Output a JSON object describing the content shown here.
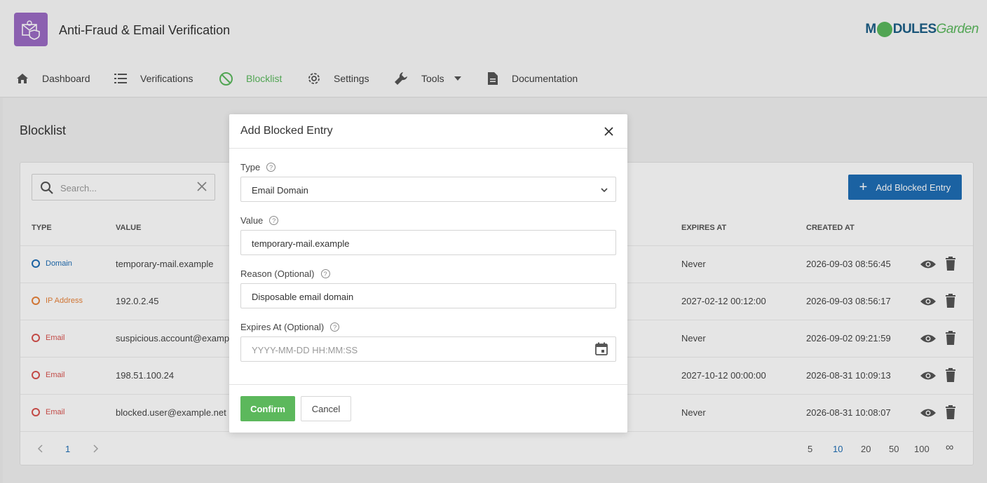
{
  "header": {
    "app_title": "Anti-Fraud & Email Verification",
    "brand": {
      "part1": "M",
      "part2": "DULES",
      "part3": "Garden"
    }
  },
  "nav": {
    "dashboard": "Dashboard",
    "verifications": "Verifications",
    "blocklist": "Blocklist",
    "settings": "Settings",
    "tools": "Tools",
    "documentation": "Documentation"
  },
  "page": {
    "title": "Blocklist",
    "search_placeholder": "Search...",
    "add_button": "Add Blocked Entry"
  },
  "table": {
    "headers": {
      "type": "TYPE",
      "value": "VALUE",
      "expires_at": "EXPIRES AT",
      "created_at": "CREATED AT"
    },
    "rows": [
      {
        "type": "Domain",
        "type_color": "#1f6eb5",
        "value": "temporary-mail.example",
        "expires": "Never",
        "created": "2026-09-03 08:56:45"
      },
      {
        "type": "IP Address",
        "type_color": "#e8833a",
        "value": "192.0.2.45",
        "expires": "2027-02-12 00:12:00",
        "created": "2026-09-03 08:56:17"
      },
      {
        "type": "Email",
        "type_color": "#d9534f",
        "value": "suspicious.account@examp",
        "expires": "Never",
        "created": "2026-09-02 09:21:59"
      },
      {
        "type": "Email",
        "type_color": "#d9534f",
        "value": "198.51.100.24",
        "expires": "2027-10-12 00:00:00",
        "created": "2026-08-31 10:09:13"
      },
      {
        "type": "Email",
        "type_color": "#d9534f",
        "value": "blocked.user@example.net",
        "expires": "Never",
        "created": "2026-08-31 10:08:07"
      }
    ]
  },
  "pagination": {
    "current": "1",
    "page_sizes": [
      "5",
      "10",
      "20",
      "50",
      "100",
      "∞"
    ],
    "selected_size": "10"
  },
  "modal": {
    "title": "Add Blocked Entry",
    "type_label": "Type",
    "type_value": "Email Domain",
    "value_label": "Value",
    "value_value": "temporary-mail.example",
    "reason_label": "Reason (Optional)",
    "reason_value": "Disposable email domain",
    "expires_label": "Expires At (Optional)",
    "expires_placeholder": "YYYY-MM-DD HH:MM:SS",
    "confirm": "Confirm",
    "cancel": "Cancel"
  },
  "colors": {
    "accent_green": "#5cb85c",
    "primary_blue": "#1f6eb5",
    "logo_purple": "#9b6bc4"
  }
}
